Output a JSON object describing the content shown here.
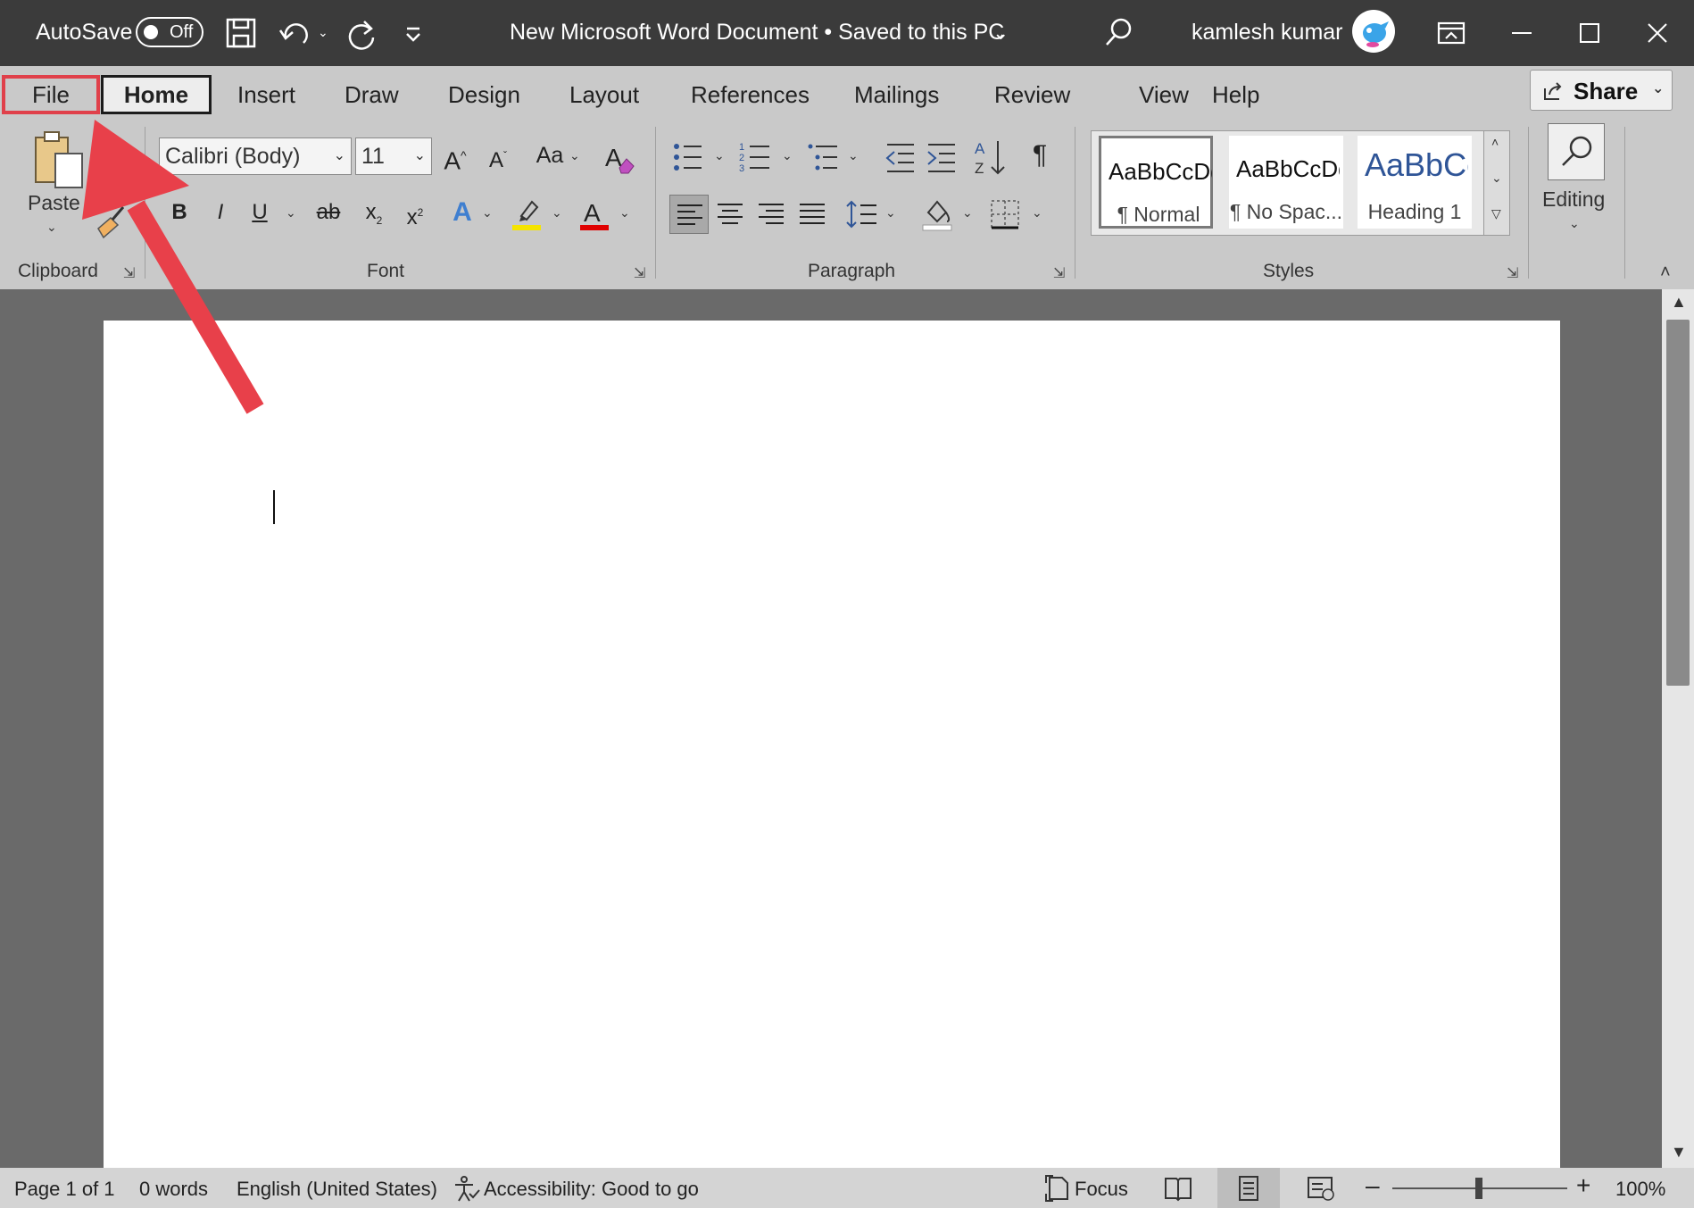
{
  "titlebar": {
    "autosave_label": "AutoSave",
    "autosave_state": "Off",
    "document_title": "New Microsoft Word Document • Saved to this PC",
    "user_name": "kamlesh kumar"
  },
  "tabs": [
    {
      "label": "File"
    },
    {
      "label": "Home"
    },
    {
      "label": "Insert"
    },
    {
      "label": "Draw"
    },
    {
      "label": "Design"
    },
    {
      "label": "Layout"
    },
    {
      "label": "References"
    },
    {
      "label": "Mailings"
    },
    {
      "label": "Review"
    },
    {
      "label": "View"
    },
    {
      "label": "Help"
    }
  ],
  "share_label": "Share",
  "ribbon": {
    "clipboard": {
      "paste_label": "Paste",
      "group_label": "Clipboard"
    },
    "font": {
      "font_name": "Calibri (Body)",
      "font_size": "11",
      "change_case": "Aa",
      "bold": "B",
      "italic": "I",
      "underline": "U",
      "strike": "ab",
      "group_label": "Font"
    },
    "paragraph": {
      "group_label": "Paragraph"
    },
    "styles": {
      "items": [
        {
          "sample": "AaBbCcDd",
          "name": "¶ Normal"
        },
        {
          "sample": "AaBbCcDd",
          "name": "¶ No Spac..."
        },
        {
          "sample": "AaBbCc",
          "name": "Heading 1"
        }
      ],
      "group_label": "Styles"
    },
    "editing": {
      "label": "Editing"
    }
  },
  "status": {
    "page": "Page 1 of 1",
    "words": "0 words",
    "language": "English (United States)",
    "accessibility": "Accessibility: Good to go",
    "focus": "Focus",
    "zoom": "100%"
  },
  "colors": {
    "highlight": "#f5e400",
    "font_color": "#e00000",
    "heading_blue": "#2f5597",
    "annotation_red": "#e0404a"
  }
}
